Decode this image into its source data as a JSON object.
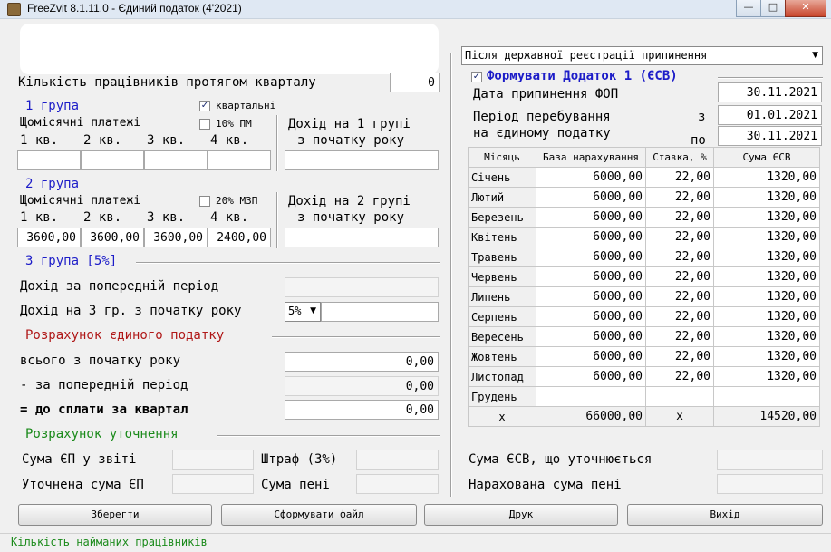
{
  "window": {
    "title": "FreeZvit 8.1.11.0 - Єдиний податок (4'2021)",
    "min": "—",
    "max": "□",
    "close": "✕"
  },
  "left": {
    "workers_label": "Кількість працівників протягом кварталу",
    "workers_value": "0",
    "g1": {
      "title": "1 група",
      "quarterly_label": "квартальні",
      "quarterly_checked": true,
      "monthly_label": "Щомісячні платежі",
      "pm_label": "10% ПМ",
      "pm_checked": false,
      "q_labels": [
        "1 кв.",
        "2 кв.",
        "3 кв.",
        "4 кв."
      ],
      "q_values": [
        "",
        "",
        "",
        ""
      ],
      "income_label_1": "Дохід на 1 групі",
      "income_label_2": "з початку року",
      "income_value": ""
    },
    "g2": {
      "title": "2 група",
      "monthly_label": "Щомісячні платежі",
      "mzp_label": "20% МЗП",
      "mzp_checked": false,
      "q_labels": [
        "1 кв.",
        "2 кв.",
        "3 кв.",
        "4 кв."
      ],
      "q_values": [
        "3600,00",
        "3600,00",
        "3600,00",
        "2400,00"
      ],
      "income_label_1": "Дохід на 2 групі",
      "income_label_2": "з початку року",
      "income_value": ""
    },
    "g3": {
      "title": "3 група [5%]",
      "prev_label": "Дохід за попередній період",
      "prev_value": "",
      "ytd_label": "Дохід на 3 гр. з початку року",
      "rate": "5%",
      "ytd_value": ""
    },
    "calc": {
      "title": "Розрахунок єдиного податку",
      "total_label": "всього з початку року",
      "total_value": "0,00",
      "prev_label": "- за попередній період",
      "prev_value": "0,00",
      "pay_label": "= до сплати за квартал",
      "pay_value": "0,00"
    },
    "clar": {
      "title": "Розрахунок уточнення",
      "sum_report_label": "Сума ЄП у звіті",
      "sum_report_value": "",
      "fine_label": "Штраф (3%)",
      "fine_value": "",
      "clarified_label": "Уточнена сума ЄП",
      "clarified_value": "",
      "penalty_label": "Сума пені",
      "penalty_value": ""
    }
  },
  "right": {
    "mode_select": "Після державної реєстрації припинення",
    "form_label": "Формувати Додаток 1 (ЄСВ)",
    "form_checked": true,
    "stop_date_label": "Дата припинення ФОП",
    "stop_date": "30.11.2021",
    "period_label_1": "Період перебування",
    "period_label_2": "на єдиному податку",
    "from_label": "з",
    "from_date": "01.01.2021",
    "to_label": "по",
    "to_date": "30.11.2021",
    "table": {
      "headers": [
        "Місяць",
        "База нарахування",
        "Ставка, %",
        "Сума ЄСВ"
      ],
      "rows": [
        {
          "month": "Січень",
          "base": "6000,00",
          "rate": "22,00",
          "sum": "1320,00"
        },
        {
          "month": "Лютий",
          "base": "6000,00",
          "rate": "22,00",
          "sum": "1320,00"
        },
        {
          "month": "Березень",
          "base": "6000,00",
          "rate": "22,00",
          "sum": "1320,00"
        },
        {
          "month": "Квітень",
          "base": "6000,00",
          "rate": "22,00",
          "sum": "1320,00"
        },
        {
          "month": "Травень",
          "base": "6000,00",
          "rate": "22,00",
          "sum": "1320,00"
        },
        {
          "month": "Червень",
          "base": "6000,00",
          "rate": "22,00",
          "sum": "1320,00"
        },
        {
          "month": "Липень",
          "base": "6000,00",
          "rate": "22,00",
          "sum": "1320,00"
        },
        {
          "month": "Серпень",
          "base": "6000,00",
          "rate": "22,00",
          "sum": "1320,00"
        },
        {
          "month": "Вересень",
          "base": "6000,00",
          "rate": "22,00",
          "sum": "1320,00"
        },
        {
          "month": "Жовтень",
          "base": "6000,00",
          "rate": "22,00",
          "sum": "1320,00"
        },
        {
          "month": "Листопад",
          "base": "6000,00",
          "rate": "22,00",
          "sum": "1320,00"
        },
        {
          "month": "Грудень",
          "base": "",
          "rate": "",
          "sum": ""
        }
      ],
      "total": {
        "month": "x",
        "base": "66000,00",
        "rate": "x",
        "sum": "14520,00"
      }
    },
    "esv_clar_label": "Сума ЄСВ, що уточнюється",
    "esv_clar_value": "",
    "penalty_label": "Нарахована сума пені",
    "penalty_value": ""
  },
  "buttons": {
    "save": "Зберегти",
    "make_file": "Сформувати файл",
    "print": "Друк",
    "exit": "Вихід"
  },
  "status": "Кількість найманих працівників"
}
